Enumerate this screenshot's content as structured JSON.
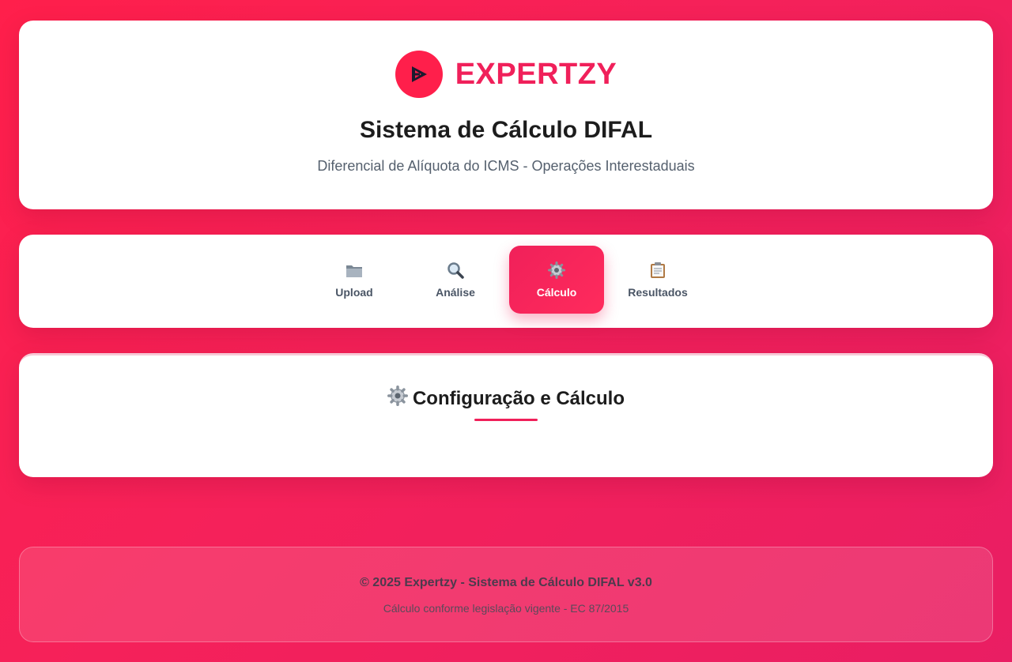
{
  "header": {
    "brand_name": "EXPERTZY",
    "logo_icon": "play-logo-icon",
    "title": "Sistema de Cálculo DIFAL",
    "subtitle": "Diferencial de Alíquota do ICMS - Operações Interestaduais"
  },
  "steps": [
    {
      "label": "Upload",
      "icon": "folder-icon",
      "active": false
    },
    {
      "label": "Análise",
      "icon": "magnifier-icon",
      "active": false
    },
    {
      "label": "Cálculo",
      "icon": "gear-icon",
      "active": true
    },
    {
      "label": "Resultados",
      "icon": "clipboard-icon",
      "active": false
    }
  ],
  "section": {
    "title": "Configuração e Cálculo",
    "icon": "gear-icon"
  },
  "footer": {
    "main": "© 2025 Expertzy - Sistema de Cálculo DIFAL v3.0",
    "sub": "Cálculo conforme legislação vigente - EC 87/2015"
  },
  "colors": {
    "accent": "#f0205a",
    "background_start": "#ff1f4b",
    "background_end": "#e91e63"
  }
}
